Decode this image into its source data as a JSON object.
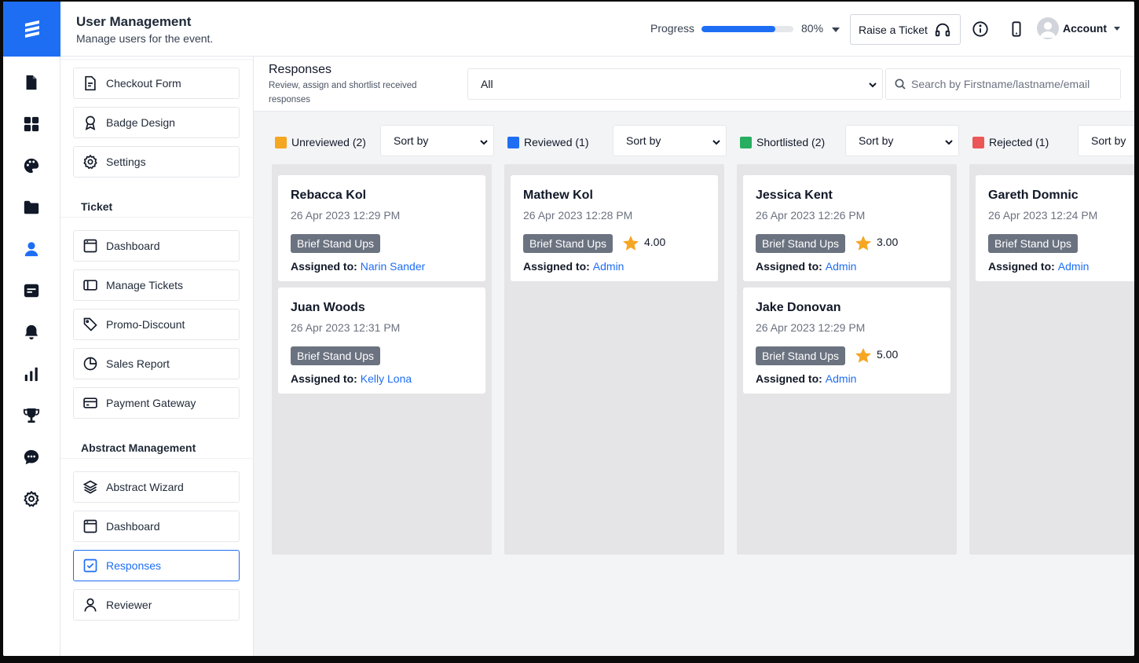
{
  "header": {
    "title": "User Management",
    "subtitle": "Manage users for the event.",
    "progress_label": "Progress",
    "progress_value": 0.8,
    "progress_text": "80%",
    "ticket_label": "Raise a Ticket",
    "account_label": "Account",
    "brand_color": "#1e6ef4"
  },
  "rail": {
    "icons": [
      "document-icon",
      "grid-icon",
      "palette-icon",
      "folder-icon",
      "user-icon",
      "form-icon",
      "bell-icon",
      "bar-chart-icon",
      "trophy-icon",
      "chat-icon",
      "gear-icon"
    ],
    "active": "user-icon"
  },
  "menu": {
    "top_items": [
      {
        "label": "Checkout Form",
        "icon": "form-file-icon"
      },
      {
        "label": "Badge Design",
        "icon": "badge-icon"
      },
      {
        "label": "Settings",
        "icon": "gear-icon"
      }
    ],
    "ticket_heading": "Ticket",
    "ticket_items": [
      {
        "label": "Dashboard",
        "icon": "browser-icon"
      },
      {
        "label": "Manage Tickets",
        "icon": "sidebar-icon"
      },
      {
        "label": "Promo-Discount",
        "icon": "tag-icon"
      },
      {
        "label": "Sales Report",
        "icon": "pie-chart-icon"
      },
      {
        "label": "Payment Gateway",
        "icon": "card-icon"
      }
    ],
    "abstract_heading": "Abstract Management",
    "abstract_items": [
      {
        "label": "Abstract Wizard",
        "icon": "layers-icon"
      },
      {
        "label": "Dashboard",
        "icon": "browser-icon"
      },
      {
        "label": "Responses",
        "icon": "checkbox-icon",
        "active": true
      },
      {
        "label": "Reviewer",
        "icon": "person-icon"
      }
    ]
  },
  "responses": {
    "title": "Responses",
    "subtitle": "Review, assign and shortlist received responses",
    "filter_value": "All",
    "search_placeholder": "Search by Firstname/lastname/email",
    "sort_label": "Sort by"
  },
  "columns": [
    {
      "label": "Unreviewed (2)",
      "color": "#f5a623",
      "cards": [
        {
          "name": "Rebacca Kol",
          "date": "26 Apr 2023 12:29 PM",
          "tag": "Brief Stand Ups",
          "rating": "",
          "assigned_label": "Assigned to:",
          "assignee": "Narin Sander"
        },
        {
          "name": "Juan Woods",
          "date": "26 Apr 2023 12:31 PM",
          "tag": "Brief Stand Ups",
          "rating": "",
          "assigned_label": "Assigned to:",
          "assignee": "Kelly Lona"
        }
      ]
    },
    {
      "label": "Reviewed (1)",
      "color": "#1e6ef4",
      "cards": [
        {
          "name": "Mathew Kol",
          "date": "26 Apr 2023 12:28 PM",
          "tag": "Brief Stand Ups",
          "rating": "4.00",
          "assigned_label": "Assigned to:",
          "assignee": "Admin"
        }
      ]
    },
    {
      "label": "Shortlisted (2)",
      "color": "#27ae60",
      "cards": [
        {
          "name": "Jessica Kent",
          "date": "26 Apr 2023 12:26 PM",
          "tag": "Brief Stand Ups",
          "rating": "3.00",
          "assigned_label": "Assigned to:",
          "assignee": "Admin"
        },
        {
          "name": "Jake Donovan",
          "date": "26 Apr 2023 12:29 PM",
          "tag": "Brief Stand Ups",
          "rating": "5.00",
          "assigned_label": "Assigned to:",
          "assignee": "Admin"
        }
      ]
    },
    {
      "label": "Rejected (1)",
      "color": "#eb5757",
      "cards": [
        {
          "name": "Gareth Domnic",
          "date": "26 Apr 2023 12:24 PM",
          "tag": "Brief Stand Ups",
          "rating": "",
          "assigned_label": "Assigned to:",
          "assignee": "Admin"
        }
      ]
    }
  ]
}
